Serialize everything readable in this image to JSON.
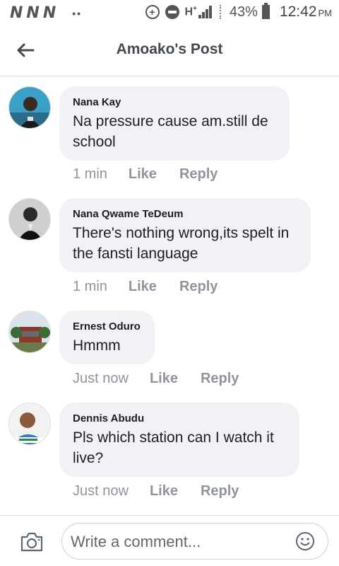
{
  "status_bar": {
    "notifications": [
      "N",
      "N",
      "N"
    ],
    "dots": "••",
    "network": "H",
    "network_sup": "+",
    "battery_percent": "43%",
    "time": "12:42",
    "time_suffix": "PM"
  },
  "header": {
    "title": "Amoako's Post",
    "back_icon": "arrow-left-icon"
  },
  "comments": [
    {
      "author": "Nana Kay",
      "text": "Na pressure cause am.still de school",
      "time": "1 min",
      "like_label": "Like",
      "reply_label": "Reply"
    },
    {
      "author": "Nana Qwame TeDeum",
      "text": "There's nothing wrong,its spelt in the fansti language",
      "time": "1 min",
      "like_label": "Like",
      "reply_label": "Reply"
    },
    {
      "author": "Ernest Oduro",
      "text": "Hmmm",
      "time": "Just now",
      "like_label": "Like",
      "reply_label": "Reply"
    },
    {
      "author": "Dennis Abudu",
      "text": "Pls which station can I watch it live?",
      "time": "Just now",
      "like_label": "Like",
      "reply_label": "Reply"
    }
  ],
  "composer": {
    "placeholder": "Write a comment...",
    "camera_icon": "camera-icon",
    "emoji_icon": "smiley-icon"
  },
  "colors": {
    "bubble": "#f0f2f5",
    "meta_text": "#90949c",
    "title_text": "#444950",
    "divider": "#dadde1"
  }
}
